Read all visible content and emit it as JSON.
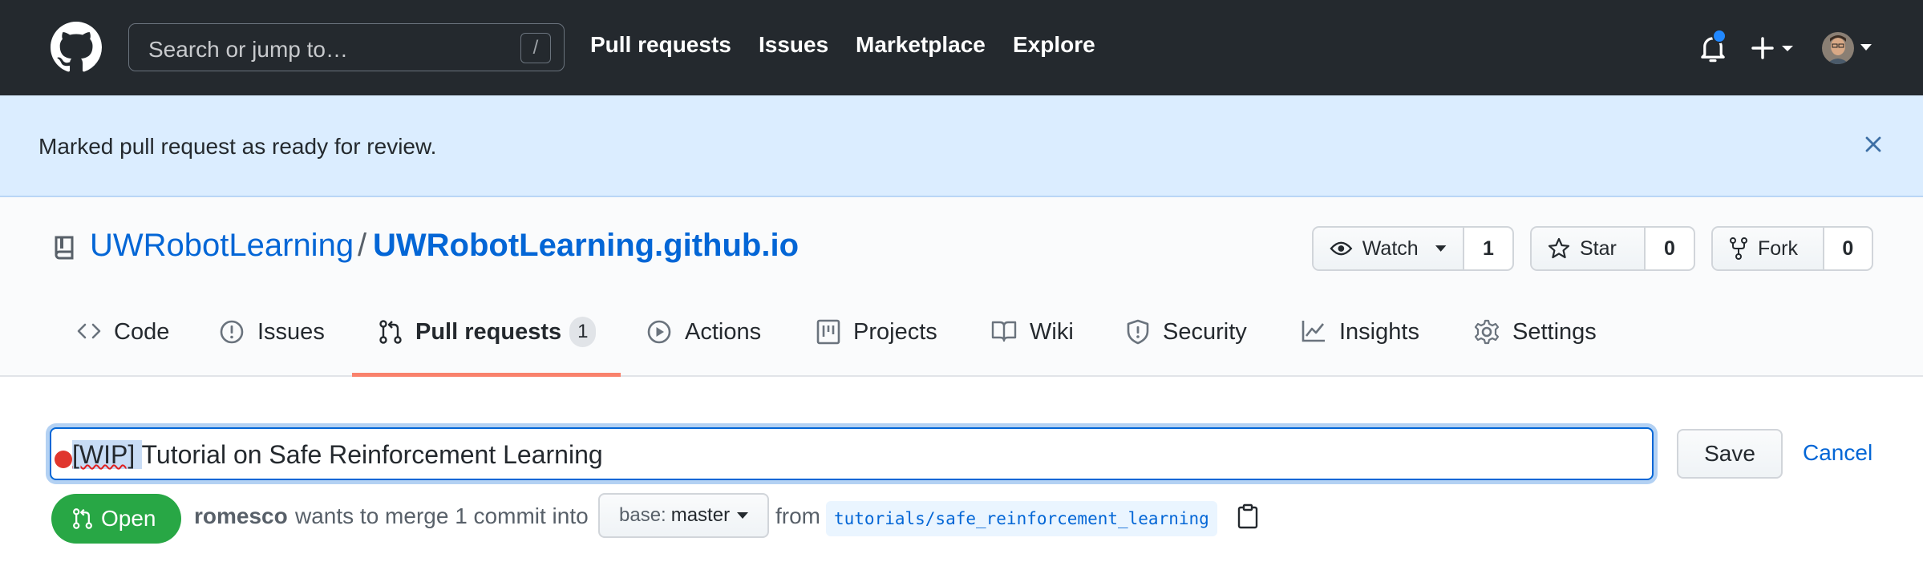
{
  "header": {
    "search_placeholder": "Search or jump to…",
    "search_shortcut": "/",
    "nav": [
      "Pull requests",
      "Issues",
      "Marketplace",
      "Explore"
    ]
  },
  "flash": {
    "message": "Marked pull request as ready for review."
  },
  "repo": {
    "owner": "UWRobotLearning",
    "separator": "/",
    "name": "UWRobotLearning.github.io",
    "watch_label": "Watch",
    "watch_count": "1",
    "star_label": "Star",
    "star_count": "0",
    "fork_label": "Fork",
    "fork_count": "0"
  },
  "tabs": [
    {
      "label": "Code",
      "icon": "code-icon"
    },
    {
      "label": "Issues",
      "icon": "issue-icon"
    },
    {
      "label": "Pull requests",
      "icon": "pull-request-icon",
      "count": "1",
      "selected": true
    },
    {
      "label": "Actions",
      "icon": "play-icon"
    },
    {
      "label": "Projects",
      "icon": "project-icon"
    },
    {
      "label": "Wiki",
      "icon": "book-icon"
    },
    {
      "label": "Security",
      "icon": "shield-icon"
    },
    {
      "label": "Insights",
      "icon": "graph-icon"
    },
    {
      "label": "Settings",
      "icon": "gear-icon"
    }
  ],
  "pr": {
    "title_prefix": "[WIP]",
    "title_rest": "Tutorial on Safe Reinforcement Learning",
    "save_label": "Save",
    "cancel_label": "Cancel",
    "state": "Open",
    "author": "romesco",
    "merge_text": "wants to merge 1 commit into",
    "base_label": "base:",
    "base_branch": "master",
    "from_text": "from",
    "head_branch": "tutorials/safe_reinforcement_learning"
  },
  "colors": {
    "header_bg": "#24292e",
    "flash_bg": "#dbedff",
    "link": "#0366d6",
    "open_green": "#28a745",
    "tab_underline": "#f9826c"
  }
}
